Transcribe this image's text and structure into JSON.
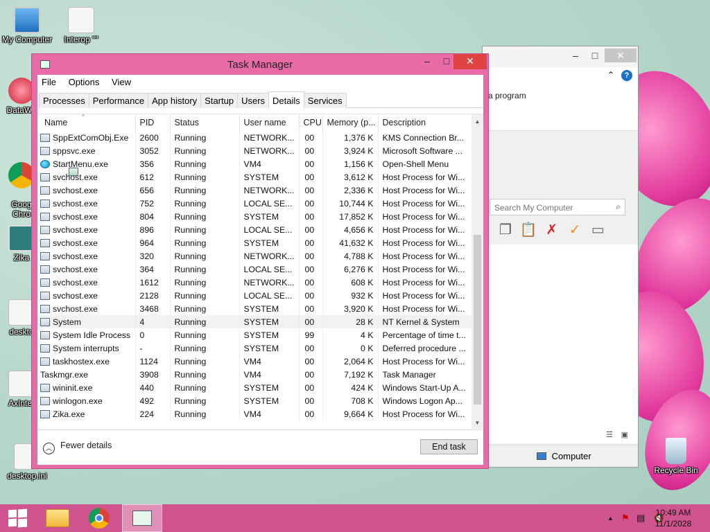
{
  "desktop": {
    "icons": [
      {
        "label": "My Computer"
      },
      {
        "label": "Interop \"\""
      },
      {
        "label": "DataWa"
      },
      {
        "label": "Goog\nChro"
      },
      {
        "label": "Zika"
      },
      {
        "label": "deskto"
      },
      {
        "label": "AxInter"
      },
      {
        "label": "desktop.ini"
      },
      {
        "label": "Recycle Bin"
      }
    ]
  },
  "explorer": {
    "ribbon_text": "a program",
    "search_placeholder": "Search My Computer",
    "status_label": "Computer"
  },
  "task_manager": {
    "title": "Task Manager",
    "menu": [
      "File",
      "Options",
      "View"
    ],
    "tabs": [
      "Processes",
      "Performance",
      "App history",
      "Startup",
      "Users",
      "Details",
      "Services"
    ],
    "active_tab": "Details",
    "columns": [
      "Name",
      "PID",
      "Status",
      "User name",
      "CPU",
      "Memory (p...",
      "Description"
    ],
    "rows": [
      {
        "name": "SppExtComObj.Exe",
        "pid": "2600",
        "status": "Running",
        "user": "NETWORK...",
        "cpu": "00",
        "mem": "1,376 K",
        "desc": "KMS Connection Br..."
      },
      {
        "name": "sppsvc.exe",
        "pid": "3052",
        "status": "Running",
        "user": "NETWORK...",
        "cpu": "00",
        "mem": "3,924 K",
        "desc": "Microsoft Software ..."
      },
      {
        "name": "StartMenu.exe",
        "pid": "356",
        "status": "Running",
        "user": "VM4",
        "cpu": "00",
        "mem": "1,156 K",
        "desc": "Open-Shell Menu",
        "icon": "shell"
      },
      {
        "name": "svchost.exe",
        "pid": "612",
        "status": "Running",
        "user": "SYSTEM",
        "cpu": "00",
        "mem": "3,612 K",
        "desc": "Host Process for Wi..."
      },
      {
        "name": "svchost.exe",
        "pid": "656",
        "status": "Running",
        "user": "NETWORK...",
        "cpu": "00",
        "mem": "2,336 K",
        "desc": "Host Process for Wi..."
      },
      {
        "name": "svchost.exe",
        "pid": "752",
        "status": "Running",
        "user": "LOCAL SE...",
        "cpu": "00",
        "mem": "10,744 K",
        "desc": "Host Process for Wi..."
      },
      {
        "name": "svchost.exe",
        "pid": "804",
        "status": "Running",
        "user": "SYSTEM",
        "cpu": "00",
        "mem": "17,852 K",
        "desc": "Host Process for Wi..."
      },
      {
        "name": "svchost.exe",
        "pid": "896",
        "status": "Running",
        "user": "LOCAL SE...",
        "cpu": "00",
        "mem": "4,656 K",
        "desc": "Host Process for Wi..."
      },
      {
        "name": "svchost.exe",
        "pid": "964",
        "status": "Running",
        "user": "SYSTEM",
        "cpu": "00",
        "mem": "41,632 K",
        "desc": "Host Process for Wi..."
      },
      {
        "name": "svchost.exe",
        "pid": "320",
        "status": "Running",
        "user": "NETWORK...",
        "cpu": "00",
        "mem": "4,788 K",
        "desc": "Host Process for Wi..."
      },
      {
        "name": "svchost.exe",
        "pid": "364",
        "status": "Running",
        "user": "LOCAL SE...",
        "cpu": "00",
        "mem": "6,276 K",
        "desc": "Host Process for Wi..."
      },
      {
        "name": "svchost.exe",
        "pid": "1612",
        "status": "Running",
        "user": "NETWORK...",
        "cpu": "00",
        "mem": "608 K",
        "desc": "Host Process for Wi..."
      },
      {
        "name": "svchost.exe",
        "pid": "2128",
        "status": "Running",
        "user": "LOCAL SE...",
        "cpu": "00",
        "mem": "932 K",
        "desc": "Host Process for Wi..."
      },
      {
        "name": "svchost.exe",
        "pid": "3468",
        "status": "Running",
        "user": "SYSTEM",
        "cpu": "00",
        "mem": "3,920 K",
        "desc": "Host Process for Wi..."
      },
      {
        "name": "System",
        "pid": "4",
        "status": "Running",
        "user": "SYSTEM",
        "cpu": "00",
        "mem": "28 K",
        "desc": "NT Kernel & System",
        "selected": true
      },
      {
        "name": "System Idle Process",
        "pid": "0",
        "status": "Running",
        "user": "SYSTEM",
        "cpu": "99",
        "mem": "4 K",
        "desc": "Percentage of time t..."
      },
      {
        "name": "System interrupts",
        "pid": "-",
        "status": "Running",
        "user": "SYSTEM",
        "cpu": "00",
        "mem": "0 K",
        "desc": "Deferred procedure ..."
      },
      {
        "name": "taskhostex.exe",
        "pid": "1124",
        "status": "Running",
        "user": "VM4",
        "cpu": "00",
        "mem": "2,064 K",
        "desc": "Host Process for Wi..."
      },
      {
        "name": "Taskmgr.exe",
        "pid": "3908",
        "status": "Running",
        "user": "VM4",
        "cpu": "00",
        "mem": "7,192 K",
        "desc": "Task Manager",
        "icon": "tm"
      },
      {
        "name": "wininit.exe",
        "pid": "440",
        "status": "Running",
        "user": "SYSTEM",
        "cpu": "00",
        "mem": "424 K",
        "desc": "Windows Start-Up A..."
      },
      {
        "name": "winlogon.exe",
        "pid": "492",
        "status": "Running",
        "user": "SYSTEM",
        "cpu": "00",
        "mem": "708 K",
        "desc": "Windows Logon Ap..."
      },
      {
        "name": "Zika.exe",
        "pid": "224",
        "status": "Running",
        "user": "VM4",
        "cpu": "00",
        "mem": "9,664 K",
        "desc": "Host Process for Wi..."
      }
    ],
    "fewer_details_label": "Fewer details",
    "end_task_label": "End task"
  },
  "taskbar": {
    "time": "10:49 AM",
    "date": "11/1/2028"
  },
  "colors": {
    "accent": "#e86ba8",
    "taskbar": "#d0548f"
  }
}
